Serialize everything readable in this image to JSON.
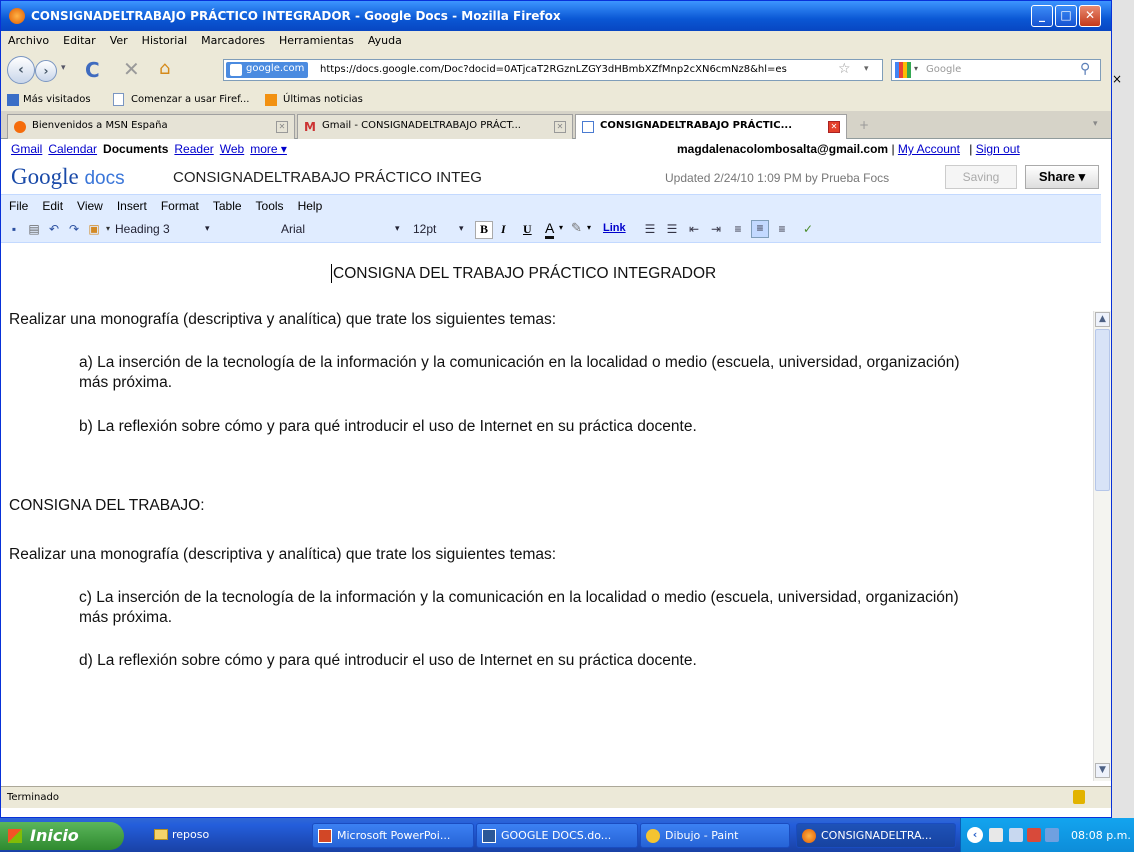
{
  "window": {
    "title": "CONSIGNADELTRABAJO PRÁCTICO INTEGRADOR - Google Docs - Mozilla Firefox",
    "buttons": [
      "_",
      "□",
      "✕"
    ]
  },
  "menubar": [
    "Archivo",
    "Editar",
    "Ver",
    "Historial",
    "Marcadores",
    "Herramientas",
    "Ayuda"
  ],
  "nav": {
    "domain_chip": "google.com",
    "url": "https://docs.google.com/Doc?docid=0ATjcaT2RGznLZGY3dHBmbXZfMnp2cXN6cmNz8&hl=es",
    "search_placeholder": "Google"
  },
  "bookmarks": [
    "Más visitados",
    "Comenzar a usar Firef...",
    "Últimas noticias"
  ],
  "tabs": [
    {
      "label": "Bienvenidos a MSN España"
    },
    {
      "label": "Gmail - CONSIGNADELTRABAJO PRÁCT..."
    },
    {
      "label": "CONSIGNADELTRABAJO PRÁCTIC..."
    }
  ],
  "gbar": {
    "links": [
      "Gmail",
      "Calendar",
      "Reader",
      "Web",
      "more ▾"
    ],
    "current": "Documents",
    "email": "magdalenacolombosalta@gmail.com",
    "my_account": "My Account",
    "sign_out": "Sign out",
    "sep": "|"
  },
  "docs": {
    "logo_google": "Google",
    "logo_docs": "docs",
    "doc_title": "CONSIGNADELTRABAJO PRÁCTICO INTEG",
    "updated": "Updated 2/24/10 1:09 PM by Prueba Focs",
    "saving": "Saving",
    "share": "Share ▾"
  },
  "gmenu": [
    "File",
    "Edit",
    "View",
    "Insert",
    "Format",
    "Table",
    "Tools",
    "Help"
  ],
  "toolbar": {
    "style": "Heading 3",
    "font": "Arial",
    "size": "12pt",
    "bold": "B",
    "italic": "I",
    "underline": "U",
    "link": "Link"
  },
  "document": {
    "heading": "CONSIGNA DEL TRABAJO PRÁCTICO INTEGRADOR",
    "intro1": "Realizar una monografía (descriptiva y analítica) que trate los siguientes temas:",
    "a_line1": "a)  La inserción de la tecnología de la información y la comunicación en la localidad o medio (escuela, universidad, organización)",
    "a_line2": "más próxima.",
    "b": "b)  La reflexión sobre cómo y para qué introducir el uso de Internet en su práctica docente.",
    "heading2": "CONSIGNA DEL TRABAJO:",
    "intro2": "Realizar una monografía (descriptiva y analítica) que trate los siguientes temas:",
    "c_line1": "c)   La inserción de la tecnología de la información y la comunicación en la localidad o medio (escuela, universidad, organización)",
    "c_line2": "más próxima.",
    "d": "d)  La reflexión sobre cómo y para qué introducir el uso de Internet en su práctica docente."
  },
  "status": "Terminado",
  "taskbar": {
    "start": "Inicio",
    "tasks": [
      "reposo",
      "Microsoft PowerPoi...",
      "GOOGLE DOCS.do...",
      "Dibujo - Paint",
      "CONSIGNADELTRA..."
    ],
    "time": "08:08 p.m."
  }
}
